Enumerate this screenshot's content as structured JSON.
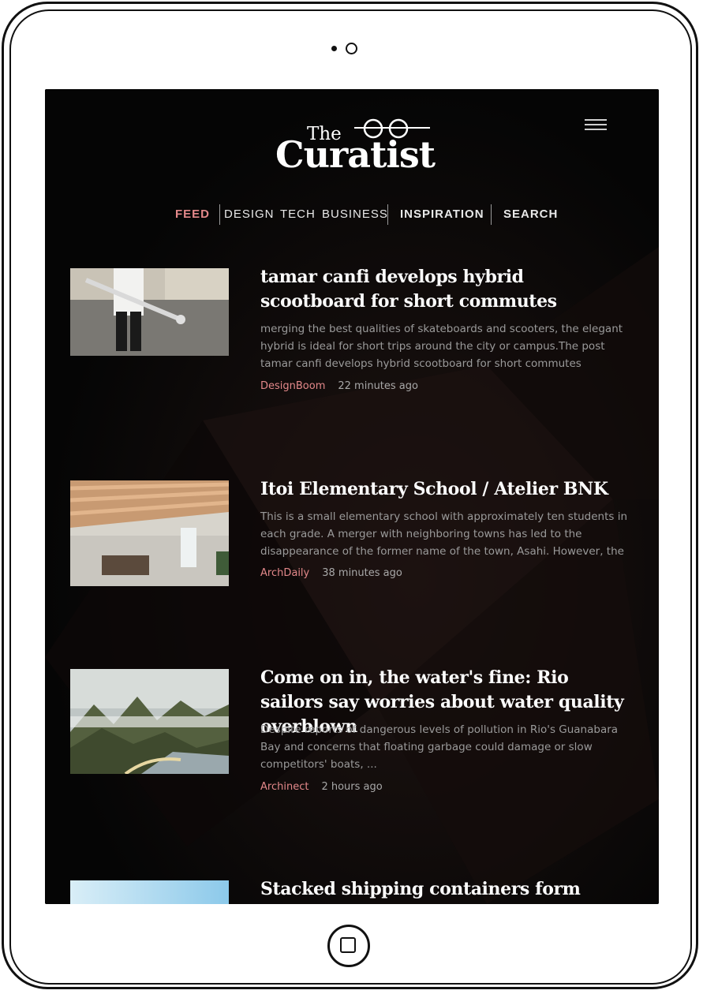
{
  "brand": {
    "logo_small": "The",
    "logo_big": "Curatist"
  },
  "nav": {
    "feed": "FEED",
    "design": "DESIGN",
    "tech": "TECH",
    "business": "BUSINESS",
    "inspiration": "INSPIRATION",
    "search": "SEARCH"
  },
  "articles": [
    {
      "title": "tamar canfi develops hybrid scootboard for short commutes",
      "excerpt": "merging the best qualities of skateboards and scooters, the elegant hybrid is ideal for short trips around the city or campus.The post tamar canfi develops hybrid scootboard for short commutes",
      "source": "DesignBoom",
      "time": "22 minutes ago"
    },
    {
      "title": "Itoi Elementary School / Atelier BNK",
      "excerpt": "This is a small elementary school with approximately ten students in each grade. A merger with neighboring towns has led to the disappearance of the former name of the town, Asahi. However, the",
      "source": "ArchDaily",
      "time": "38 minutes ago"
    },
    {
      "title": "Come on in, the water's fine: Rio sailors say worries about water quality overblown",
      "excerpt": "Despite reports of dangerous levels of pollution in Rio's Guanabara Bay and concerns that floating garbage could damage or slow competitors' boats, ...",
      "source": "Archinect",
      "time": "2 hours ago"
    },
    {
      "title": "Stacked shipping containers form"
    }
  ],
  "colors": {
    "accent": "#e3888a",
    "background": "#050505",
    "text": "#fbfbfb"
  }
}
